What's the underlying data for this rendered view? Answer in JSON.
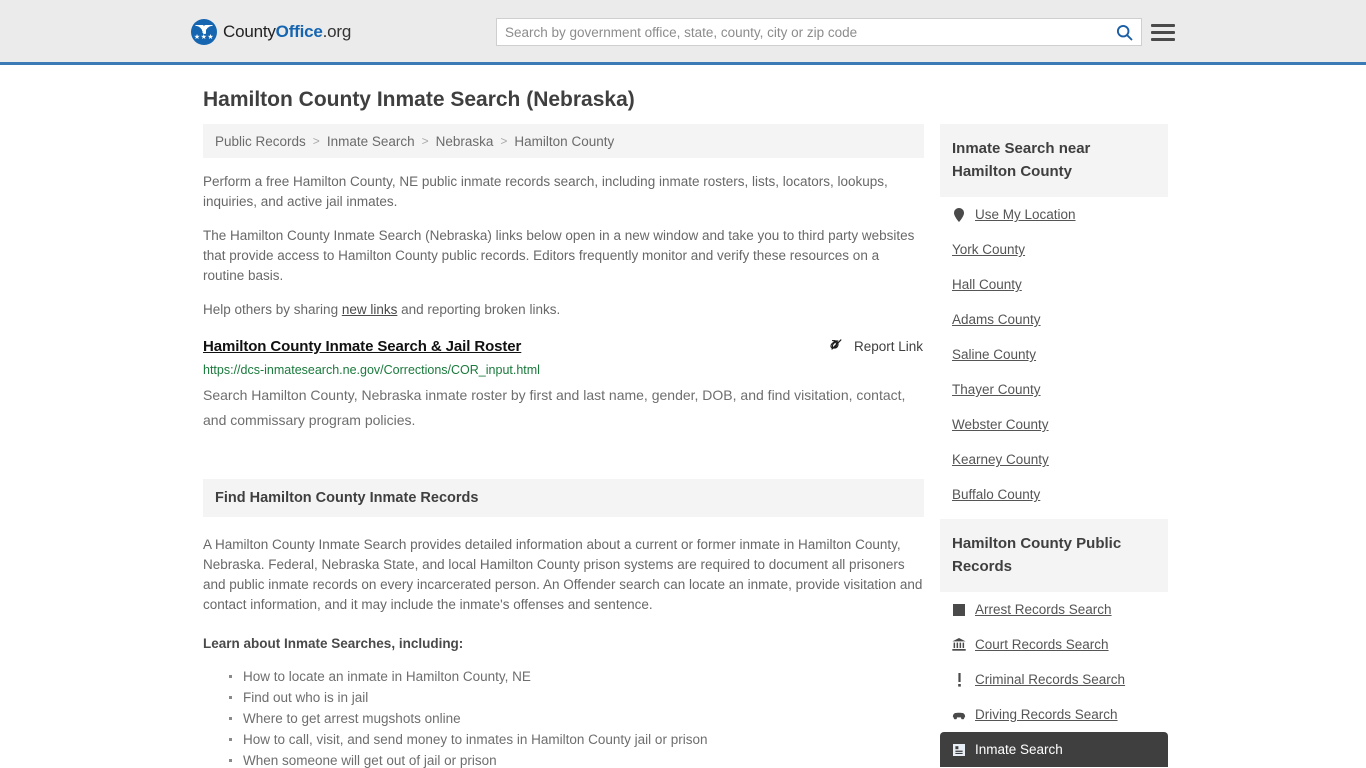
{
  "header": {
    "logo": {
      "part1": "County",
      "part2": "Office",
      "part3": ".org",
      "icon": "eagle-shield-icon",
      "stars": "★★★"
    },
    "search": {
      "placeholder": "Search by government office, state, county, city or zip code",
      "value": "",
      "button_icon": "search-icon"
    },
    "menu_icon": "hamburger-menu-icon",
    "accent_color": "#3b7ab5",
    "background_color": "#ebebec"
  },
  "page": {
    "title": "Hamilton County Inmate Search (Nebraska)"
  },
  "breadcrumb": {
    "items": [
      {
        "label": "Public Records"
      },
      {
        "label": "Inmate Search"
      },
      {
        "label": "Nebraska"
      },
      {
        "label": "Hamilton County"
      }
    ],
    "separator": ">"
  },
  "intro": {
    "paragraph1": "Perform a free Hamilton County, NE public inmate records search, including inmate rosters, lists, locators, lookups, inquiries, and active jail inmates.",
    "paragraph2": "The Hamilton County Inmate Search (Nebraska) links below open in a new window and take you to third party websites that provide access to Hamilton County public records. Editors frequently monitor and verify these resources on a routine basis.",
    "paragraph3_before": "Help others by sharing ",
    "paragraph3_link": "new links",
    "paragraph3_after": " and reporting broken links."
  },
  "result": {
    "title": "Hamilton County Inmate Search & Jail Roster",
    "url": "https://dcs-inmatesearch.ne.gov/Corrections/COR_input.html",
    "description": "Search Hamilton County, Nebraska inmate roster by first and last name, gender, DOB, and find visitation, contact, and commissary program policies.",
    "report_label": "Report Link",
    "report_icon": "broken-link-icon",
    "url_color": "#1a7a3c"
  },
  "section": {
    "heading": "Find Hamilton County Inmate Records",
    "paragraph": "A Hamilton County Inmate Search provides detailed information about a current or former inmate in Hamilton County, Nebraska. Federal, Nebraska State, and local Hamilton County prison systems are required to document all prisoners and public inmate records on every incarcerated person. An Offender search can locate an inmate, provide visitation and contact information, and it may include the inmate's offenses and sentence.",
    "lead_in": "Learn about Inmate Searches, including:",
    "bullets": [
      "How to locate an inmate in Hamilton County, NE",
      "Find out who is in jail",
      "Where to get arrest mugshots online",
      "How to call, visit, and send money to inmates in Hamilton County jail or prison",
      "When someone will get out of jail or prison"
    ]
  },
  "sidebar": {
    "nearby": {
      "heading": "Inmate Search near Hamilton County",
      "items": [
        {
          "label": "Use My Location",
          "icon": "map-pin-icon"
        },
        {
          "label": "York County",
          "icon": ""
        },
        {
          "label": "Hall County",
          "icon": ""
        },
        {
          "label": "Adams County",
          "icon": ""
        },
        {
          "label": "Saline County",
          "icon": ""
        },
        {
          "label": "Thayer County",
          "icon": ""
        },
        {
          "label": "Webster County",
          "icon": ""
        },
        {
          "label": "Kearney County",
          "icon": ""
        },
        {
          "label": "Buffalo County",
          "icon": ""
        }
      ]
    },
    "public_records": {
      "heading": "Hamilton County Public Records",
      "items": [
        {
          "label": "Arrest Records Search",
          "icon": "fingerprint-square-icon",
          "active": false
        },
        {
          "label": "Court Records Search",
          "icon": "courthouse-icon",
          "active": false
        },
        {
          "label": "Criminal Records Search",
          "icon": "exclamation-icon",
          "active": false
        },
        {
          "label": "Driving Records Search",
          "icon": "car-icon",
          "active": false
        },
        {
          "label": "Inmate Search",
          "icon": "inmate-id-icon",
          "active": true
        }
      ],
      "active_background": "#3f3f3f"
    }
  }
}
